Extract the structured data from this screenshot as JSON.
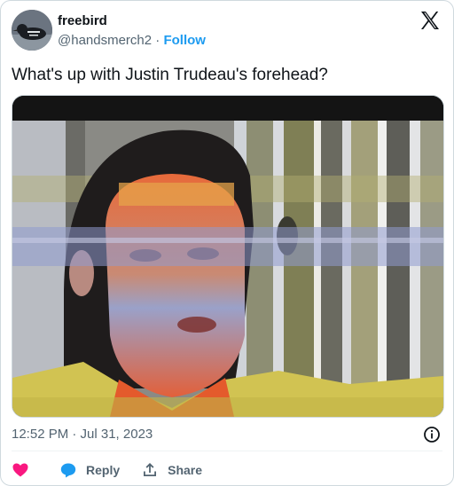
{
  "author": {
    "display_name": "freebird",
    "handle": "@handsmerch2",
    "separator": "·",
    "follow_label": "Follow"
  },
  "tweet": {
    "text": "What's up with Justin Trudeau's forehead?",
    "timestamp": "12:52 PM · Jul 31, 2023"
  },
  "actions": {
    "reply_label": "Reply",
    "share_label": "Share"
  },
  "colors": {
    "follow": "#1d9bf0",
    "like": "#f91880",
    "reply": "#1d9bf0",
    "secondary_text": "#536471"
  },
  "icons": [
    "x-logo-icon",
    "info-icon",
    "heart-icon",
    "reply-icon",
    "share-icon"
  ]
}
